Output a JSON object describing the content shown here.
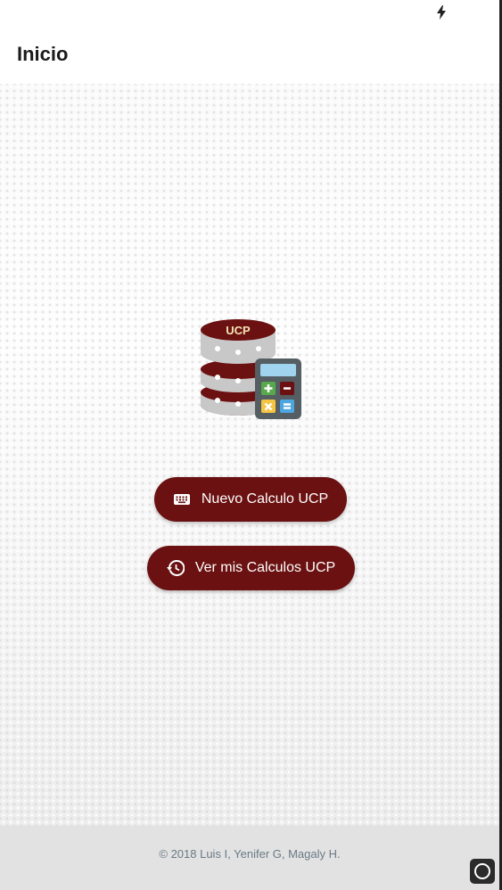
{
  "status_bar": {
    "icon": "flash-icon"
  },
  "app_bar": {
    "title": "Inicio"
  },
  "logo": {
    "badge_text": "UCP",
    "icon": "database-calculator-icon",
    "colors": {
      "maroon": "#6b1111",
      "disk_gray": "#c8c8c8",
      "calc_body": "#555e63",
      "calc_screen": "#9fd3ee",
      "plus": "#58a94c",
      "minus": "#6b1111",
      "times": "#f5c542",
      "equals": "#4da6e0"
    }
  },
  "buttons": {
    "new_calc": {
      "label": "Nuevo Calculo UCP",
      "icon": "keyboard-icon"
    },
    "history": {
      "label": "Ver mis Calculos UCP",
      "icon": "history-icon"
    }
  },
  "footer": {
    "copyright": "© 2018 Luis I, Yenifer G, Magaly H."
  },
  "colors": {
    "accent": "#6b1111",
    "footer_bg": "#e2e2e2",
    "footer_text": "#6a7a85"
  }
}
